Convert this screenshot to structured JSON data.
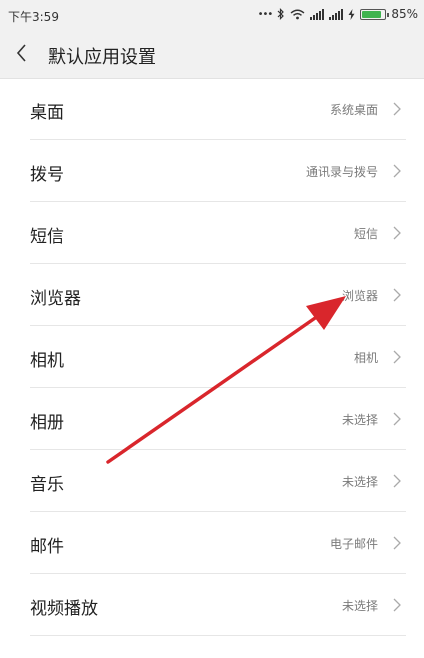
{
  "status_bar": {
    "time": "下午3:59",
    "dots": "•••",
    "battery_percent": "85%",
    "battery_level": 0.85
  },
  "header": {
    "title": "默认应用设置"
  },
  "rows": [
    {
      "label": "桌面",
      "value": "系统桌面"
    },
    {
      "label": "拨号",
      "value": "通讯录与拨号"
    },
    {
      "label": "短信",
      "value": "短信"
    },
    {
      "label": "浏览器",
      "value": "浏览器"
    },
    {
      "label": "相机",
      "value": "相机"
    },
    {
      "label": "相册",
      "value": "未选择"
    },
    {
      "label": "音乐",
      "value": "未选择"
    },
    {
      "label": "邮件",
      "value": "电子邮件"
    },
    {
      "label": "视频播放",
      "value": "未选择"
    }
  ],
  "colors": {
    "annotation_arrow": "#d9262c",
    "battery_fill": "#3fb34f"
  },
  "icons": {
    "back": "chevron-left-icon",
    "row": "chevron-right-icon"
  }
}
